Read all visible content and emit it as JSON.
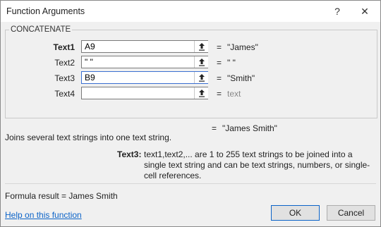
{
  "window": {
    "title": "Function Arguments",
    "help_glyph": "?",
    "close_glyph": "✕"
  },
  "function": {
    "name": "CONCATENATE",
    "args": [
      {
        "label": "Text1",
        "value": "A9",
        "result": "\"James\""
      },
      {
        "label": "Text2",
        "value": "\" \"",
        "result": "\" \""
      },
      {
        "label": "Text3",
        "value": "B9",
        "result": "\"Smith\""
      },
      {
        "label": "Text4",
        "value": "",
        "result": "text"
      }
    ],
    "equals": "=",
    "overall_result": "\"James Smith\"",
    "description": "Joins several text strings into one text string.",
    "arg_help": {
      "label": "Text3:",
      "text": "text1,text2,... are 1 to 255 text strings to be joined into a single text string and can be text strings, numbers, or single-cell references."
    }
  },
  "footer": {
    "formula_result": "Formula result =   James Smith",
    "help_link": "Help on this function",
    "ok_label": "OK",
    "cancel_label": "Cancel"
  },
  "colors": {
    "link": "#0b63c8",
    "focus": "#0b63c8"
  }
}
